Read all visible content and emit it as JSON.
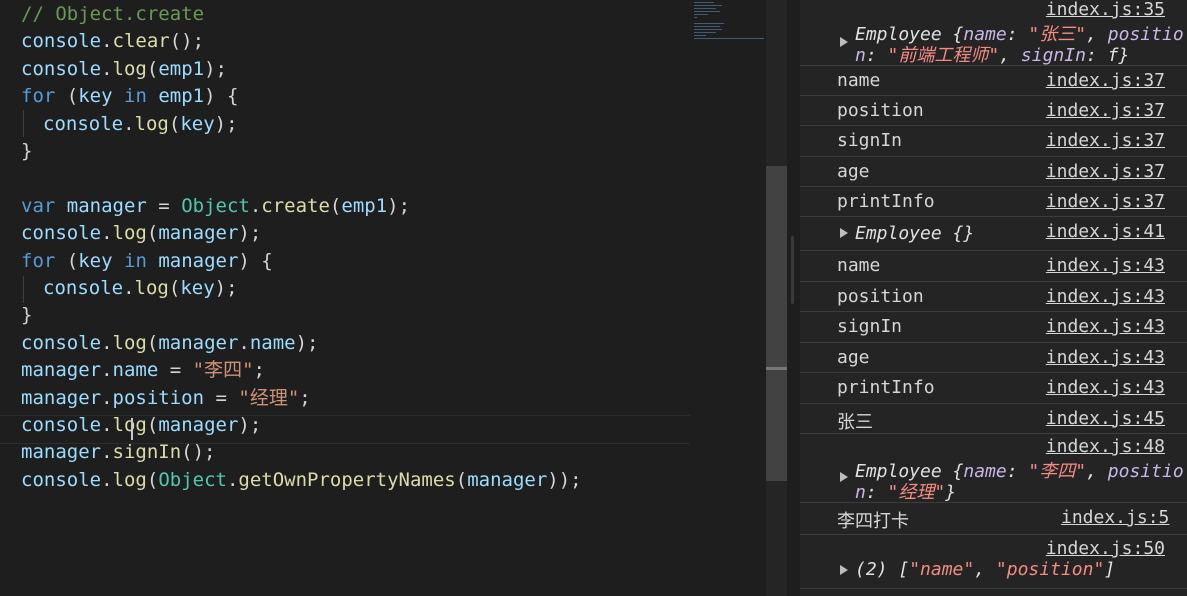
{
  "editor": {
    "lines": [
      {
        "tokens": [
          [
            "t-comment",
            "// Object.create"
          ]
        ]
      },
      {
        "tokens": [
          [
            "t-var",
            "console"
          ],
          [
            "t-punc",
            "."
          ],
          [
            "t-fn",
            "clear"
          ],
          [
            "t-punc",
            "();"
          ]
        ]
      },
      {
        "tokens": [
          [
            "t-var",
            "console"
          ],
          [
            "t-punc",
            "."
          ],
          [
            "t-fn",
            "log"
          ],
          [
            "t-punc",
            "("
          ],
          [
            "t-var",
            "emp1"
          ],
          [
            "t-punc",
            ");"
          ]
        ]
      },
      {
        "tokens": [
          [
            "t-kw",
            "for"
          ],
          [
            "t-punc",
            " ("
          ],
          [
            "t-var",
            "key"
          ],
          [
            "t-punc",
            " "
          ],
          [
            "t-kw",
            "in"
          ],
          [
            "t-punc",
            " "
          ],
          [
            "t-var",
            "emp1"
          ],
          [
            "t-punc",
            ") {"
          ]
        ]
      },
      {
        "indent": true,
        "tokens": [
          [
            "t-var",
            "console"
          ],
          [
            "t-punc",
            "."
          ],
          [
            "t-fn",
            "log"
          ],
          [
            "t-punc",
            "("
          ],
          [
            "t-var",
            "key"
          ],
          [
            "t-punc",
            ");"
          ]
        ]
      },
      {
        "tokens": [
          [
            "t-punc",
            "}"
          ]
        ]
      },
      {
        "tokens": []
      },
      {
        "tokens": [
          [
            "t-kw",
            "var"
          ],
          [
            "t-punc",
            " "
          ],
          [
            "t-var",
            "manager"
          ],
          [
            "t-punc",
            " = "
          ],
          [
            "t-cls",
            "Object"
          ],
          [
            "t-punc",
            "."
          ],
          [
            "t-fn",
            "create"
          ],
          [
            "t-punc",
            "("
          ],
          [
            "t-var",
            "emp1"
          ],
          [
            "t-punc",
            ");"
          ]
        ]
      },
      {
        "tokens": [
          [
            "t-var",
            "console"
          ],
          [
            "t-punc",
            "."
          ],
          [
            "t-fn",
            "log"
          ],
          [
            "t-punc",
            "("
          ],
          [
            "t-var",
            "manager"
          ],
          [
            "t-punc",
            ");"
          ]
        ]
      },
      {
        "tokens": [
          [
            "t-kw",
            "for"
          ],
          [
            "t-punc",
            " ("
          ],
          [
            "t-var",
            "key"
          ],
          [
            "t-punc",
            " "
          ],
          [
            "t-kw",
            "in"
          ],
          [
            "t-punc",
            " "
          ],
          [
            "t-var",
            "manager"
          ],
          [
            "t-punc",
            ") {"
          ]
        ]
      },
      {
        "indent": true,
        "tokens": [
          [
            "t-var",
            "console"
          ],
          [
            "t-punc",
            "."
          ],
          [
            "t-fn",
            "log"
          ],
          [
            "t-punc",
            "("
          ],
          [
            "t-var",
            "key"
          ],
          [
            "t-punc",
            ");"
          ]
        ]
      },
      {
        "tokens": [
          [
            "t-punc",
            "}"
          ]
        ]
      },
      {
        "tokens": [
          [
            "t-var",
            "console"
          ],
          [
            "t-punc",
            "."
          ],
          [
            "t-fn",
            "log"
          ],
          [
            "t-punc",
            "("
          ],
          [
            "t-var",
            "manager"
          ],
          [
            "t-punc",
            "."
          ],
          [
            "t-var",
            "name"
          ],
          [
            "t-punc",
            ");"
          ]
        ]
      },
      {
        "tokens": [
          [
            "t-var",
            "manager"
          ],
          [
            "t-punc",
            "."
          ],
          [
            "t-var",
            "name"
          ],
          [
            "t-punc",
            " = "
          ],
          [
            "t-str",
            "\"李四\""
          ],
          [
            "t-punc",
            ";"
          ]
        ]
      },
      {
        "tokens": [
          [
            "t-var",
            "manager"
          ],
          [
            "t-punc",
            "."
          ],
          [
            "t-var",
            "position"
          ],
          [
            "t-punc",
            " = "
          ],
          [
            "t-str",
            "\"经理\""
          ],
          [
            "t-punc",
            ";"
          ]
        ]
      },
      {
        "tokens": [
          [
            "t-var",
            "console"
          ],
          [
            "t-punc",
            "."
          ],
          [
            "t-fn",
            "log"
          ],
          [
            "t-punc",
            "("
          ],
          [
            "t-var",
            "manager"
          ],
          [
            "t-punc",
            ");"
          ]
        ]
      },
      {
        "tokens": [
          [
            "t-var",
            "manager"
          ],
          [
            "t-punc",
            "."
          ],
          [
            "t-fn",
            "signIn"
          ],
          [
            "t-punc",
            "();"
          ]
        ]
      },
      {
        "tokens": [
          [
            "t-var",
            "console"
          ],
          [
            "t-punc",
            "."
          ],
          [
            "t-fn",
            "log"
          ],
          [
            "t-punc",
            "("
          ],
          [
            "t-cls",
            "Object"
          ],
          [
            "t-punc",
            "."
          ],
          [
            "t-fn",
            "getOwnPropertyNames"
          ],
          [
            "t-punc",
            "("
          ],
          [
            "t-var",
            "manager"
          ],
          [
            "t-punc",
            "));"
          ]
        ]
      }
    ]
  },
  "console": {
    "r1_src": "index.js:35",
    "r1_l1": [
      [
        "c-plain",
        "Employee {"
      ],
      [
        "c-key",
        "name"
      ],
      [
        "c-plain",
        ": "
      ],
      [
        "c-str",
        "\"张三\""
      ],
      [
        "c-plain",
        ", "
      ],
      [
        "c-key",
        "positio"
      ]
    ],
    "r1_l2": [
      [
        "c-key",
        "n"
      ],
      [
        "c-plain",
        ": "
      ],
      [
        "c-str",
        "\"前端工程师\""
      ],
      [
        "c-plain",
        ", "
      ],
      [
        "c-key",
        "signIn"
      ],
      [
        "c-plain",
        ": f}"
      ]
    ],
    "simple1": [
      {
        "msg": "name",
        "src": "index.js:37"
      },
      {
        "msg": "position",
        "src": "index.js:37"
      },
      {
        "msg": "signIn",
        "src": "index.js:37"
      },
      {
        "msg": "age",
        "src": "index.js:37"
      },
      {
        "msg": "printInfo",
        "src": "index.js:37"
      }
    ],
    "r7_text": "Employee {}",
    "r7_src": "index.js:41",
    "simple2": [
      {
        "msg": "name",
        "src": "index.js:43"
      },
      {
        "msg": "position",
        "src": "index.js:43"
      },
      {
        "msg": "signIn",
        "src": "index.js:43"
      },
      {
        "msg": "age",
        "src": "index.js:43"
      },
      {
        "msg": "printInfo",
        "src": "index.js:43"
      },
      {
        "msg": "张三",
        "src": "index.js:45"
      }
    ],
    "r14_src": "index.js:48",
    "r14_l1": [
      [
        "c-plain",
        "Employee {"
      ],
      [
        "c-key",
        "name"
      ],
      [
        "c-plain",
        ": "
      ],
      [
        "c-str",
        "\"李四\""
      ],
      [
        "c-plain",
        ", "
      ],
      [
        "c-key",
        "positio"
      ]
    ],
    "r14_l2": [
      [
        "c-key",
        "n"
      ],
      [
        "c-plain",
        ": "
      ],
      [
        "c-str",
        "\"经理\""
      ],
      [
        "c-plain",
        "}"
      ]
    ],
    "r15_msg": "李四打卡",
    "r15_src": "index.js:5",
    "r16_src": "index.js:50",
    "r16_l1": [
      [
        "c-plain",
        "(2) ["
      ],
      [
        "c-str",
        "\"name\""
      ],
      [
        "c-plain",
        ", "
      ],
      [
        "c-str",
        "\"position\""
      ],
      [
        "c-plain",
        "]"
      ]
    ]
  }
}
